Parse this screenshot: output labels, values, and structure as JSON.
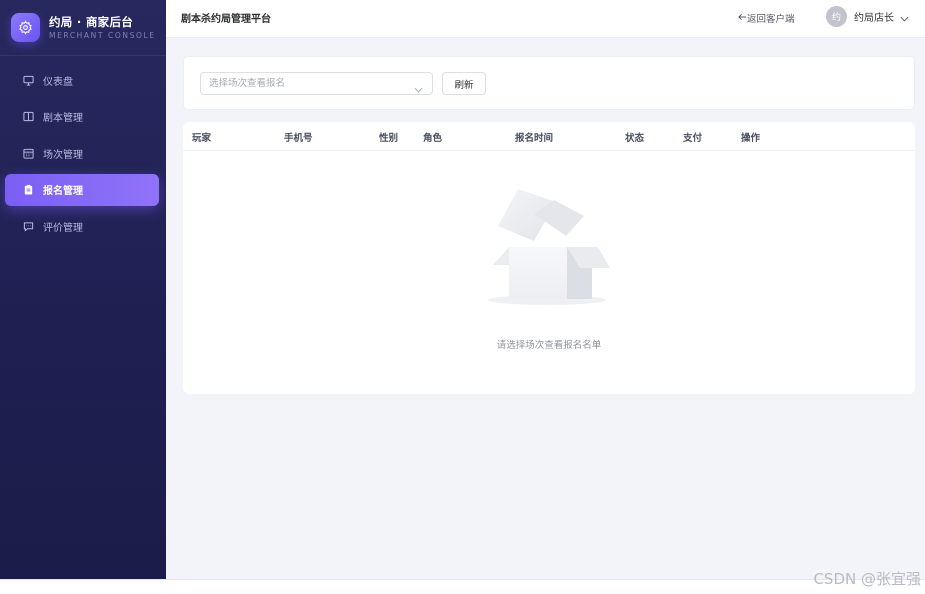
{
  "brand": {
    "title": "约局 · 商家后台",
    "subtitle": "MERCHANT CONSOLE"
  },
  "sidebar": {
    "items": [
      {
        "label": "仪表盘",
        "icon": "monitor-icon"
      },
      {
        "label": "剧本管理",
        "icon": "book-icon"
      },
      {
        "label": "场次管理",
        "icon": "calendar-icon"
      },
      {
        "label": "报名管理",
        "icon": "clipboard-icon",
        "active": true
      },
      {
        "label": "评价管理",
        "icon": "chat-icon"
      }
    ]
  },
  "header": {
    "title": "剧本杀约局管理平台",
    "back_label": "返回客户端",
    "user": {
      "avatar_text": "约",
      "name": "约局店长"
    }
  },
  "filter": {
    "select_placeholder": "选择场次查看报名",
    "refresh_label": "刷新"
  },
  "table": {
    "columns": [
      "玩家",
      "手机号",
      "性别",
      "角色",
      "报名时间",
      "状态",
      "支付",
      "操作"
    ],
    "rows": [],
    "empty_text": "请选择场次查看报名名单"
  },
  "watermark": "CSDN @张宜强",
  "colors": {
    "accent": "#7b5ff4",
    "sidebar_bg": "#1f2052",
    "main_bg": "#f3f4fa"
  }
}
